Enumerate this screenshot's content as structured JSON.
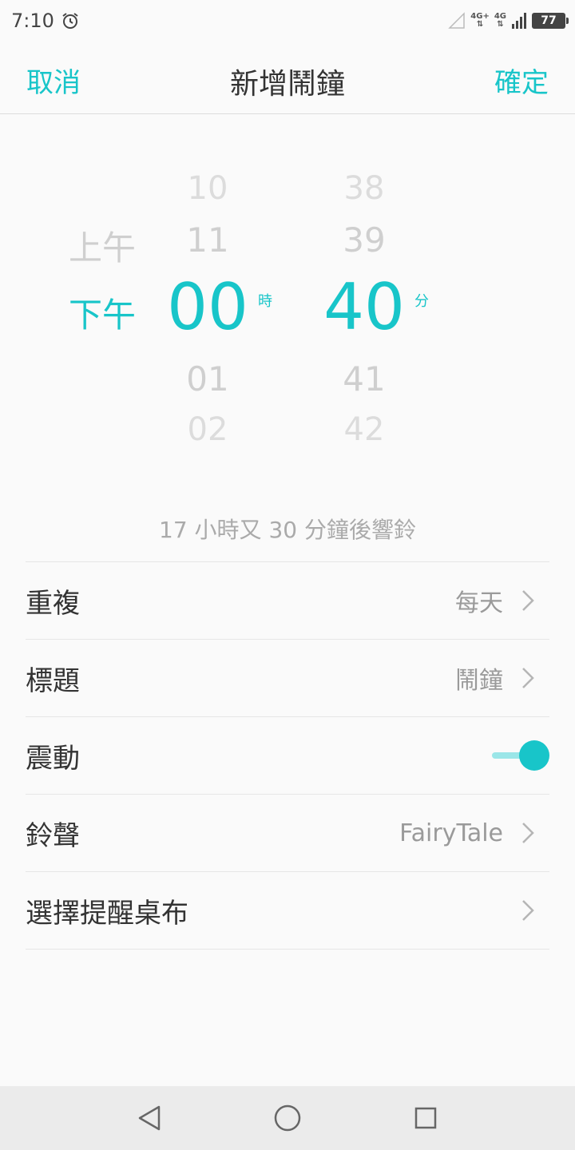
{
  "status_bar": {
    "time": "7:10",
    "network_1": "4G+",
    "network_2": "4G",
    "battery": "77"
  },
  "header": {
    "cancel_label": "取消",
    "title": "新增鬧鐘",
    "confirm_label": "確定"
  },
  "picker": {
    "ampm": {
      "above": "上午",
      "selected": "下午"
    },
    "hours": {
      "above2": "10",
      "above1": "11",
      "selected": "00",
      "below1": "01",
      "below2": "02",
      "unit": "時"
    },
    "minutes": {
      "above2": "38",
      "above1": "39",
      "selected": "40",
      "below1": "41",
      "below2": "42",
      "unit": "分"
    }
  },
  "countdown": "17 小時又 30 分鐘後響鈴",
  "settings": {
    "repeat": {
      "label": "重複",
      "value": "每天"
    },
    "title": {
      "label": "標題",
      "value": "鬧鐘"
    },
    "vibrate": {
      "label": "震動",
      "enabled": true
    },
    "ringtone": {
      "label": "鈴聲",
      "value": "FairyTale"
    },
    "wallpaper": {
      "label": "選擇提醒桌布"
    }
  },
  "colors": {
    "accent": "#18c5c9",
    "accent_light": "#9be6e8"
  }
}
